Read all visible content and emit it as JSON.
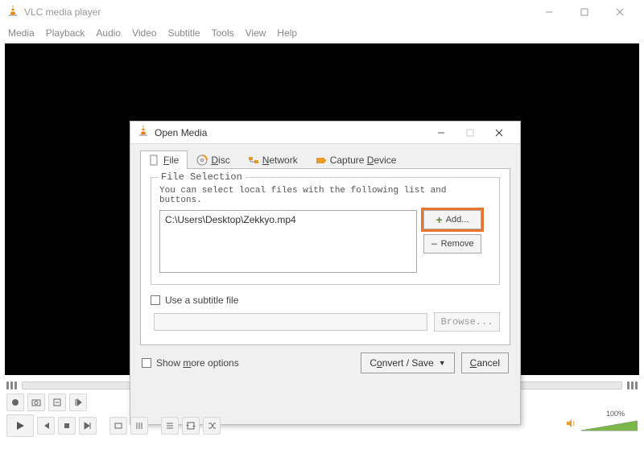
{
  "app": {
    "title": "VLC media player"
  },
  "menu": {
    "items": [
      "Media",
      "Playback",
      "Audio",
      "Video",
      "Subtitle",
      "Tools",
      "View",
      "Help"
    ]
  },
  "controls": {
    "volume_label": "100%"
  },
  "dialog": {
    "title": "Open Media",
    "tabs": {
      "file": {
        "prefix": "F",
        "rest": "ile"
      },
      "disc": {
        "prefix": "D",
        "rest": "isc"
      },
      "network": {
        "prefix": "N",
        "rest": "etwork"
      },
      "capture": {
        "prefix": "D",
        "label_before": "Capture ",
        "rest": "evice"
      }
    },
    "file_section": {
      "legend": "File Selection",
      "help": "You can select local files with the following list and buttons.",
      "files": [
        "C:\\Users\\Desktop\\Zekkyo.mp4"
      ],
      "add_label": "Add...",
      "remove_label": "Remove"
    },
    "subtitle": {
      "checkbox_label": "Use a subtitle file",
      "browse_label": "Browse..."
    },
    "show_more": {
      "pre": "Show ",
      "u": "m",
      "post": "ore options"
    },
    "convert": {
      "pre": "C",
      "u": "o",
      "post": "nvert / Save"
    },
    "cancel": {
      "u": "C",
      "post": "ancel"
    }
  }
}
